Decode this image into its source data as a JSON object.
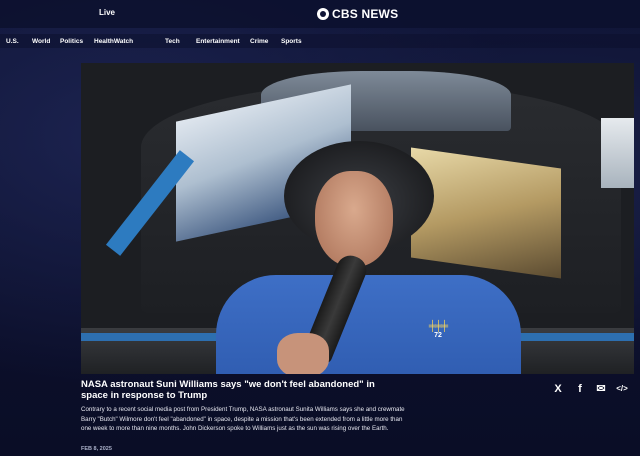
{
  "header": {
    "live_label": "Live",
    "logo_text": "CBS NEWS"
  },
  "nav": {
    "items": [
      "U.S.",
      "World",
      "Politics",
      "HealthWatch",
      "Tech",
      "Entertainment",
      "Crime",
      "Sports"
    ]
  },
  "video": {
    "patch_number": "72"
  },
  "article": {
    "headline": "NASA astronaut Suni Williams says \"we don't feel abandoned\" in space in response to Trump",
    "summary": "Contrary to a recent social media post from President Trump, NASA astronaut Sunita Williams says she and crewmate Barry \"Butch\" Wilmore don't feel \"abandoned\" in space, despite a mission that's been extended from a little more than one week to more than nine months. John Dickerson spoke to Williams just as the sun was rising over the Earth.",
    "date": "FEB 8, 2025"
  },
  "share": {
    "x_icon": "X",
    "facebook_icon": "f",
    "email_icon": "✉",
    "embed_icon": "</>"
  },
  "colors": {
    "background": "#0b0f2c",
    "shirt_blue": "#3e6fc6",
    "accent_blue": "#2d7bc0"
  }
}
